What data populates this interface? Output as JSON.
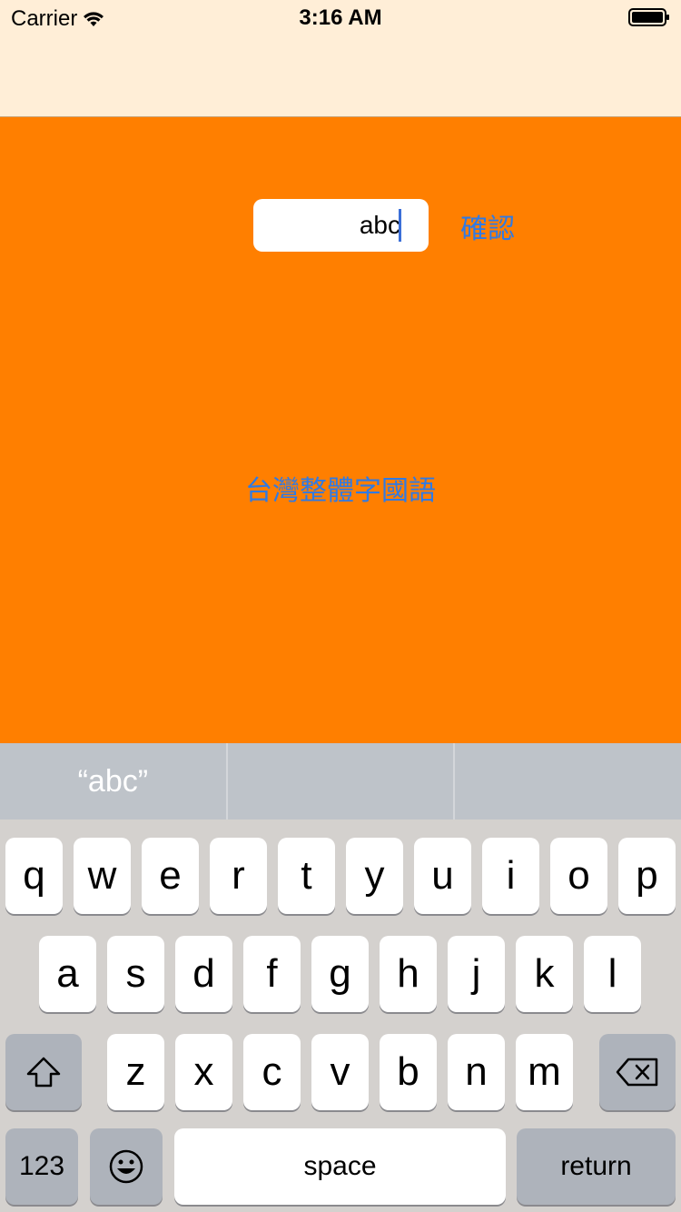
{
  "status_bar": {
    "carrier": "Carrier",
    "time": "3:16 AM"
  },
  "content": {
    "text_field_value": "abc",
    "confirm_label": "確認",
    "center_label": "台灣整體字國語"
  },
  "keyboard": {
    "suggestions": [
      "“abc”",
      "",
      ""
    ],
    "row1": [
      "q",
      "w",
      "e",
      "r",
      "t",
      "y",
      "u",
      "i",
      "o",
      "p"
    ],
    "row2": [
      "a",
      "s",
      "d",
      "f",
      "g",
      "h",
      "j",
      "k",
      "l"
    ],
    "row3": [
      "z",
      "x",
      "c",
      "v",
      "b",
      "n",
      "m"
    ],
    "numbers_label": "123",
    "space_label": "space",
    "return_label": "return"
  },
  "colors": {
    "background": "#ff7f00",
    "nav_bar": "#ffeed7",
    "tint": "#2f7ae5"
  },
  "icons": {
    "wifi": "wifi-icon",
    "battery": "battery-icon",
    "shift": "shift-arrow-icon",
    "delete": "backspace-icon",
    "emoji": "emoji-face-icon"
  }
}
